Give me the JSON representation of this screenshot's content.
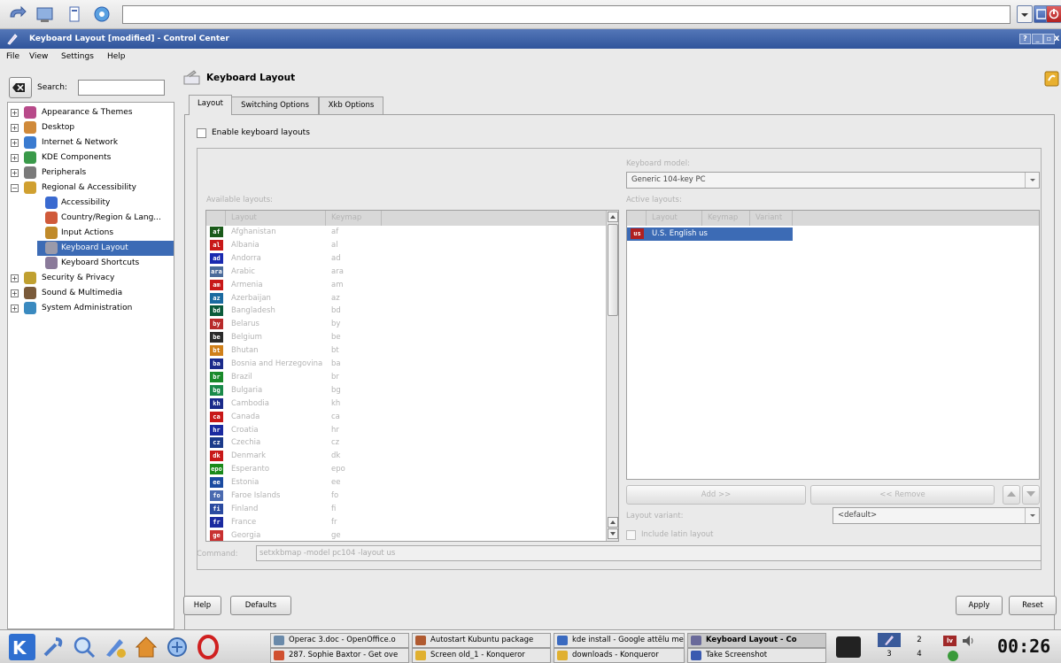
{
  "window": {
    "title": "Keyboard Layout [modified] - Control Center"
  },
  "menubar": [
    "File",
    "View",
    "Settings",
    "Help"
  ],
  "search": {
    "label": "Search:",
    "value": ""
  },
  "tree": [
    {
      "label": "Appearance & Themes",
      "icon": "appearance-icon",
      "color": "#b84a8a"
    },
    {
      "label": "Desktop",
      "icon": "desktop-icon",
      "color": "#d08a3a"
    },
    {
      "label": "Internet & Network",
      "icon": "globe-icon",
      "color": "#3a7bd0"
    },
    {
      "label": "KDE Components",
      "icon": "components-icon",
      "color": "#3a9a4a"
    },
    {
      "label": "Peripherals",
      "icon": "peripherals-icon",
      "color": "#7a7a7a"
    },
    {
      "label": "Regional & Accessibility",
      "icon": "regional-icon",
      "color": "#d0a030"
    },
    {
      "label": "Accessibility",
      "icon": "accessibility-icon",
      "color": "#3a6ad0"
    },
    {
      "label": "Country/Region & Lang...",
      "icon": "country-icon",
      "color": "#d05a3a"
    },
    {
      "label": "Input Actions",
      "icon": "input-actions-icon",
      "color": "#c08a2a"
    },
    {
      "label": "Keyboard Layout",
      "icon": "keyboard-layout-icon",
      "color": "#9a9aaa"
    },
    {
      "label": "Keyboard Shortcuts",
      "icon": "keyboard-shortcuts-icon",
      "color": "#8a7a9a"
    },
    {
      "label": "Security & Privacy",
      "icon": "security-icon",
      "color": "#c0a030"
    },
    {
      "label": "Sound & Multimedia",
      "icon": "sound-icon",
      "color": "#7a5a3a"
    },
    {
      "label": "System Administration",
      "icon": "sysadmin-icon",
      "color": "#3a8ac0"
    }
  ],
  "page": {
    "title": "Keyboard Layout"
  },
  "tabs": [
    "Layout",
    "Switching Options",
    "Xkb Options"
  ],
  "enable_label": "Enable keyboard layouts",
  "keyboard_model": {
    "label": "Keyboard model:",
    "value": "Generic 104-key PC"
  },
  "available": {
    "label": "Available layouts:",
    "headers": [
      "Layout",
      "Keymap"
    ],
    "rows": [
      {
        "flag": "af",
        "name": "Afghanistan",
        "keymap": "af",
        "color": "#1a5a1a"
      },
      {
        "flag": "al",
        "name": "Albania",
        "keymap": "al",
        "color": "#c81818"
      },
      {
        "flag": "ad",
        "name": "Andorra",
        "keymap": "ad",
        "color": "#1a2ab0"
      },
      {
        "flag": "ara",
        "name": "Arabic",
        "keymap": "ara",
        "color": "#4a6a9a"
      },
      {
        "flag": "am",
        "name": "Armenia",
        "keymap": "am",
        "color": "#c81818"
      },
      {
        "flag": "az",
        "name": "Azerbaijan",
        "keymap": "az",
        "color": "#1a6aa0"
      },
      {
        "flag": "bd",
        "name": "Bangladesh",
        "keymap": "bd",
        "color": "#0a5a3a"
      },
      {
        "flag": "by",
        "name": "Belarus",
        "keymap": "by",
        "color": "#b82a2a"
      },
      {
        "flag": "be",
        "name": "Belgium",
        "keymap": "be",
        "color": "#2a2a2a"
      },
      {
        "flag": "bt",
        "name": "Bhutan",
        "keymap": "bt",
        "color": "#d0801a"
      },
      {
        "flag": "ba",
        "name": "Bosnia and Herzegovina",
        "keymap": "ba",
        "color": "#1a2a8a"
      },
      {
        "flag": "br",
        "name": "Brazil",
        "keymap": "br",
        "color": "#1a8a2a"
      },
      {
        "flag": "bg",
        "name": "Bulgaria",
        "keymap": "bg",
        "color": "#1a8a4a"
      },
      {
        "flag": "kh",
        "name": "Cambodia",
        "keymap": "kh",
        "color": "#1a2a8a"
      },
      {
        "flag": "ca",
        "name": "Canada",
        "keymap": "ca",
        "color": "#c81818"
      },
      {
        "flag": "hr",
        "name": "Croatia",
        "keymap": "hr",
        "color": "#1a2aa0"
      },
      {
        "flag": "cz",
        "name": "Czechia",
        "keymap": "cz",
        "color": "#1a3a8a"
      },
      {
        "flag": "dk",
        "name": "Denmark",
        "keymap": "dk",
        "color": "#c81818"
      },
      {
        "flag": "epo",
        "name": "Esperanto",
        "keymap": "epo",
        "color": "#1a8a1a"
      },
      {
        "flag": "ee",
        "name": "Estonia",
        "keymap": "ee",
        "color": "#1a4aa0"
      },
      {
        "flag": "fo",
        "name": "Faroe Islands",
        "keymap": "fo",
        "color": "#4a6ab0"
      },
      {
        "flag": "fi",
        "name": "Finland",
        "keymap": "fi",
        "color": "#2a4aa0"
      },
      {
        "flag": "fr",
        "name": "France",
        "keymap": "fr",
        "color": "#1a2aa0"
      },
      {
        "flag": "ge",
        "name": "Georgia",
        "keymap": "ge",
        "color": "#c83030"
      }
    ]
  },
  "active": {
    "label": "Active layouts:",
    "headers": [
      "Layout",
      "Keymap",
      "Variant"
    ],
    "rows": [
      {
        "flag": "us",
        "text": "U.S. English us",
        "color": "#b02020"
      }
    ]
  },
  "buttons": {
    "add": "Add >>",
    "remove": "<< Remove",
    "help": "Help",
    "defaults": "Defaults",
    "apply": "Apply",
    "reset": "Reset"
  },
  "layout_variant": {
    "label": "Layout variant:",
    "value": "<default>"
  },
  "include_latin": "Include latin layout",
  "command": {
    "label": "Command:",
    "value": "setxkbmap -model pc104 -layout us"
  },
  "taskbar": {
    "tasks": [
      {
        "label": "Operac 3.doc - OpenOffice.o",
        "color": "#6a8aaa"
      },
      {
        "label": "Autostart Kubuntu package",
        "color": "#b05a30"
      },
      {
        "label": "kde install - Google attēlu me",
        "color": "#3a6ac0"
      },
      {
        "label": "Keyboard Layout - Co",
        "color": "#6a6a9a",
        "active": true
      },
      {
        "label": "287. Sophie Baxtor - Get ove",
        "color": "#d05030"
      },
      {
        "label": "Screen old_1 - Konqueror",
        "color": "#e0b030"
      },
      {
        "label": "downloads - Konqueror",
        "color": "#e0b030"
      },
      {
        "label": "Take Screenshot",
        "color": "#3a5ab0"
      }
    ],
    "pager": [
      "2",
      "3",
      "4"
    ],
    "clock": "00:26"
  }
}
